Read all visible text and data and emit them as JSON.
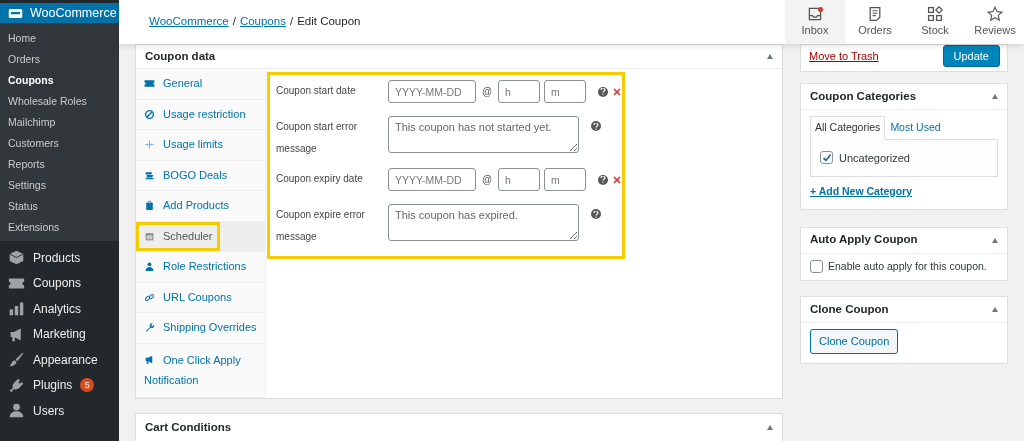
{
  "sidebar": {
    "header": "WooCommerce",
    "submenu": [
      {
        "label": "Home",
        "selected": false
      },
      {
        "label": "Orders",
        "selected": false
      },
      {
        "label": "Coupons",
        "selected": true
      },
      {
        "label": "Wholesale Roles",
        "selected": false
      },
      {
        "label": "Mailchimp",
        "selected": false
      },
      {
        "label": "Customers",
        "selected": false
      },
      {
        "label": "Reports",
        "selected": false
      },
      {
        "label": "Settings",
        "selected": false
      },
      {
        "label": "Status",
        "selected": false
      },
      {
        "label": "Extensions",
        "selected": false
      }
    ],
    "menu": [
      {
        "label": "Products"
      },
      {
        "label": "Coupons"
      },
      {
        "label": "Analytics"
      },
      {
        "label": "Marketing"
      },
      {
        "label": "Appearance"
      },
      {
        "label": "Plugins",
        "badge": "5"
      },
      {
        "label": "Users"
      }
    ]
  },
  "breadcrumb": [
    {
      "label": "WooCommerce",
      "link": true
    },
    {
      "label": "Coupons",
      "link": true,
      "separator": "/"
    },
    {
      "label": "Edit Coupon",
      "link": false,
      "separator": "/"
    }
  ],
  "activity_panel": [
    {
      "label": "Inbox",
      "selected": true,
      "unread": true
    },
    {
      "label": "Orders",
      "selected": false,
      "unread": false
    },
    {
      "label": "Stock",
      "selected": false,
      "unread": false
    },
    {
      "label": "Reviews",
      "selected": false,
      "unread": false
    }
  ],
  "coupon_data": {
    "title": "Coupon data",
    "highlighted": true,
    "tabs": [
      {
        "label": "General",
        "selected": false,
        "highlighted": false
      },
      {
        "label": "Usage restriction",
        "selected": false,
        "highlighted": false
      },
      {
        "label": "Usage limits",
        "selected": false,
        "highlighted": false
      },
      {
        "label": "BOGO Deals",
        "selected": false,
        "highlighted": false
      },
      {
        "label": "Add Products",
        "selected": false,
        "highlighted": false
      },
      {
        "label": "Scheduler",
        "selected": true,
        "highlighted": true
      },
      {
        "label": "Role Restrictions",
        "selected": false,
        "highlighted": false
      },
      {
        "label": "URL Coupons",
        "selected": false,
        "highlighted": false
      },
      {
        "label": "Shipping Overrides",
        "selected": false,
        "highlighted": false
      },
      {
        "label": "One Click Apply Notification",
        "selected": false,
        "highlighted": false
      }
    ],
    "fields": [
      {
        "kind": "datetime",
        "label": "Coupon start date",
        "date_placeholder": "YYYY-MM-DD",
        "separator": "@",
        "hour_placeholder": "h",
        "minute_placeholder": "m"
      },
      {
        "kind": "textarea",
        "label": "Coupon start error message",
        "placeholder": "This coupon has not started yet."
      },
      {
        "kind": "datetime",
        "label": "Coupon expiry date",
        "date_placeholder": "YYYY-MM-DD",
        "separator": "@",
        "hour_placeholder": "h",
        "minute_placeholder": "m"
      },
      {
        "kind": "textarea",
        "label": "Coupon expire error message",
        "placeholder": "This coupon has expired."
      }
    ]
  },
  "publish": {
    "trash_link": "Move to Trash",
    "button": "Update"
  },
  "categories": {
    "title": "Coupon Categories",
    "tabs": [
      {
        "label": "All Categories",
        "selected": true
      },
      {
        "label": "Most Used",
        "selected": false
      }
    ],
    "items": [
      {
        "label": "Uncategorized",
        "checked": true
      }
    ],
    "add_link": "+ Add New Category"
  },
  "auto_apply": {
    "title": "Auto Apply Coupon",
    "checkbox": {
      "label": "Enable auto apply for this coupon.",
      "checked": false
    }
  },
  "clone": {
    "title": "Clone Coupon",
    "button": "Clone Coupon"
  },
  "cart_conditions": {
    "title": "Cart Conditions"
  }
}
